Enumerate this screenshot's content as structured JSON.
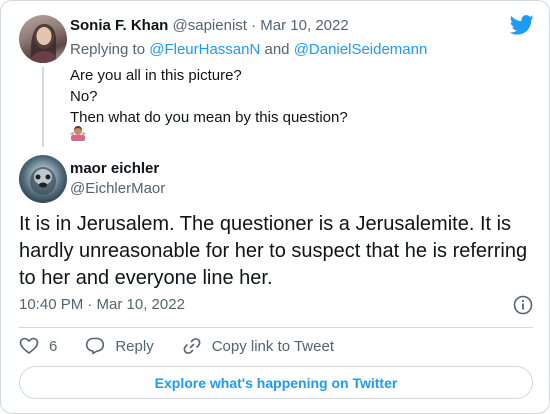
{
  "quoted_tweet": {
    "author_name": "Sonia F. Khan",
    "author_handle": "@sapienist",
    "separator": "·",
    "date": "Mar 10, 2022",
    "replying_prefix": "Replying to",
    "replying_to_1": "@FleurHassanN",
    "replying_and": "and",
    "replying_to_2": "@DanielSeidemann",
    "lines": [
      "Are you all in this picture?",
      "No?",
      "Then what do you mean by this question?"
    ]
  },
  "main_tweet": {
    "author_name": "maor eichler",
    "author_handle": "@EichlerMaor",
    "text": "It is in Jerusalem. The questioner is a Jerusalemite. It is hardly unreasonable for her to suspect that he is referring to her and everyone line her.",
    "timestamp": "10:40 PM · Mar 10, 2022"
  },
  "actions": {
    "like_count": "6",
    "reply_label": "Reply",
    "copy_link_label": "Copy link to Tweet"
  },
  "explore_label": "Explore what's happening on Twitter",
  "colors": {
    "brand_blue": "#1d9bf0",
    "muted": "#536471",
    "text": "#0f1419",
    "border": "#cfd9de"
  },
  "icons": [
    "twitter-bird-icon",
    "person-shrugging-emoji-icon",
    "info-icon",
    "heart-icon",
    "reply-bubble-icon",
    "link-icon"
  ]
}
